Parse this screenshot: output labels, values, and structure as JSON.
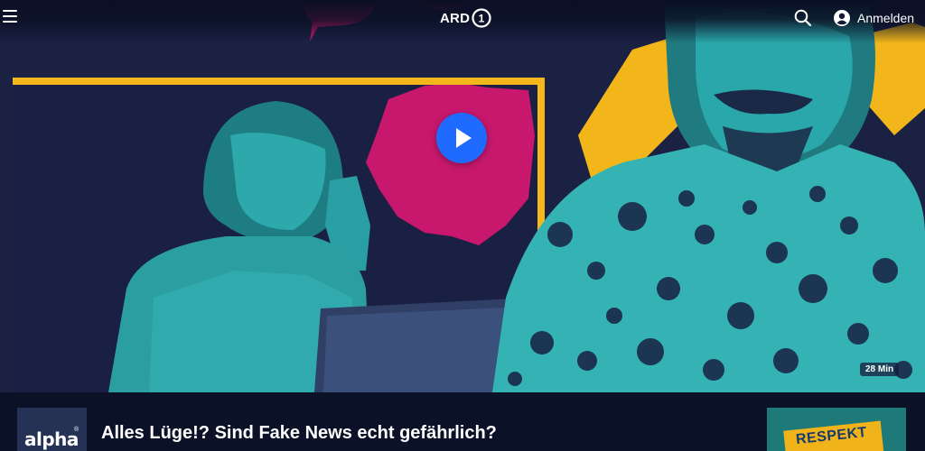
{
  "header": {
    "menu_icon": "hamburger-menu-icon",
    "logo_text": "ARD",
    "logo_mark": "1",
    "search_icon": "search-icon",
    "account_icon": "user-circle-icon",
    "login_label": "Anmelden"
  },
  "hero": {
    "play_icon": "play-icon",
    "duration": "28 Min"
  },
  "info": {
    "channel_logo_text": "alpha",
    "channel_logo_mark": "®",
    "title": "Alles Lüge!? Sind Fake News echt gefährlich?",
    "next_thumbnail_text": "RESPEKT"
  },
  "colors": {
    "background": "#0b1228",
    "accent_play": "#1f6bff",
    "frame_yellow": "#f5b81c",
    "magenta": "#d0196e",
    "teal": "#35b3b4"
  }
}
